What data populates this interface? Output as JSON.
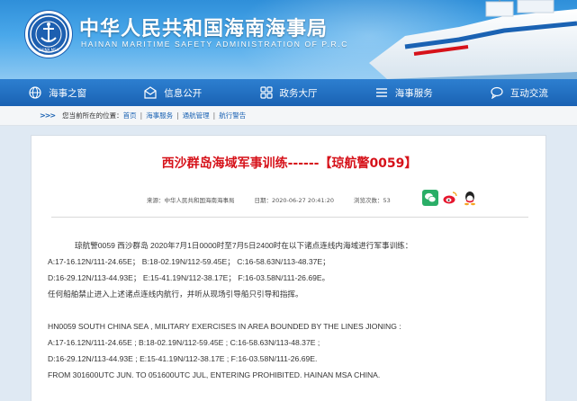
{
  "header": {
    "title": "中华人民共和国海南海事局",
    "subtitle": "HAINAN MARITIME SAFETY ADMINISTRATION OF P.R.C",
    "logo_text": "CHINA MSA"
  },
  "nav": {
    "items": [
      {
        "label": "海事之窗",
        "icon": "globe-icon"
      },
      {
        "label": "信息公开",
        "icon": "envelope-icon"
      },
      {
        "label": "政务大厅",
        "icon": "grid-icon"
      },
      {
        "label": "海事服务",
        "icon": "list-icon"
      },
      {
        "label": "互动交流",
        "icon": "chat-icon"
      }
    ]
  },
  "breadcrumb": {
    "prefix": "您当前所在的位置：",
    "items": [
      "首页",
      "海事服务",
      "通航管理",
      "航行警告"
    ]
  },
  "article": {
    "title": "西沙群岛海域军事训练------【琼航警0059】",
    "source": "来源：中华人民共和国海南海事局",
    "date": "日期：2020-06-27 20:41:20",
    "views": "浏览次数：53",
    "paragraphs_cn": [
      "琼航警0059 西沙群岛 2020年7月1日0000时至7月5日2400时在以下诸点连线内海域进行军事训练：",
      "A:17-16.12N/111-24.65E；  B:18-02.19N/112-59.45E；  C:16-58.63N/113-48.37E；",
      "D:16-29.12N/113-44.93E；  E:15-41.19N/112-38.17E；  F:16-03.58N/111-26.69E。",
      "任何船舶禁止进入上述诸点连线内航行，并听从现场引导船只引导和指挥。"
    ],
    "paragraphs_en": [
      "HN0059  SOUTH CHINA SEA , MILITARY EXERCISES IN AREA BOUNDED BY THE LINES JIONING :",
      "A:17-16.12N/111-24.65E ;   B:18-02.19N/112-59.45E ;   C:16-58.63N/113-48.37E ;",
      "D:16-29.12N/113-44.93E ;   E:15-41.19N/112-38.17E ;   F:16-03.58N/111-26.69E.",
      " FROM 301600UTC JUN. TO 051600UTC JUL, ENTERING PROHIBITED. HAINAN MSA CHINA."
    ]
  },
  "share": [
    "wechat-icon",
    "weibo-icon",
    "qq-icon"
  ],
  "colors": {
    "nav_bg": "#1a62b3",
    "title_red": "#d6121a",
    "link_blue": "#1a62b3"
  }
}
